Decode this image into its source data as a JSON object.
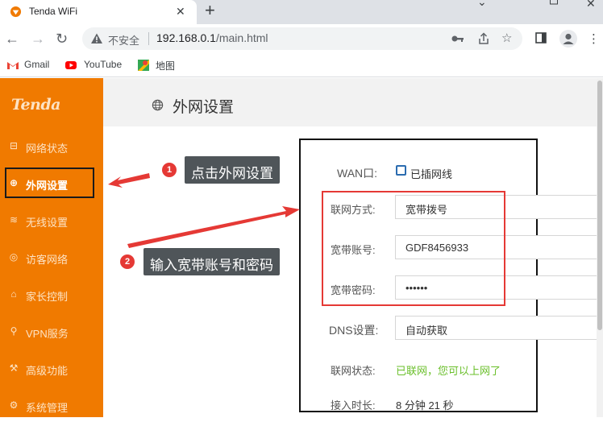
{
  "browser": {
    "tab_title": "Tenda WiFi",
    "tab_close": "✕",
    "new_tab": "+",
    "insecure_label": "不安全",
    "url_host": "192.168.0.1",
    "url_path": "/main.html",
    "bookmarks": [
      {
        "label": "Gmail",
        "icon": "gmail-icon"
      },
      {
        "label": "YouTube",
        "icon": "youtube-icon"
      },
      {
        "label": "地图",
        "icon": "maps-icon"
      }
    ]
  },
  "sidebar": {
    "logo": "Tenda",
    "items": [
      {
        "label": "网络状态",
        "icon": "router-icon"
      },
      {
        "label": "外网设置",
        "icon": "globe-icon",
        "active": true
      },
      {
        "label": "无线设置",
        "icon": "wifi-icon"
      },
      {
        "label": "访客网络",
        "icon": "guest-icon"
      },
      {
        "label": "家长控制",
        "icon": "parental-icon"
      },
      {
        "label": "VPN服务",
        "icon": "vpn-icon"
      },
      {
        "label": "高级功能",
        "icon": "tools-icon"
      },
      {
        "label": "系统管理",
        "icon": "settings-icon"
      }
    ]
  },
  "header": {
    "title": "外网设置"
  },
  "form": {
    "wan_label": "WAN口:",
    "wan_status": "已插网线",
    "conn_type_label": "联网方式:",
    "conn_type_value": "宽带拨号",
    "account_label": "宽带账号:",
    "account_value": "GDF8456933",
    "password_label": "宽带密码:",
    "password_value": "••••••",
    "dns_label": "DNS设置:",
    "dns_value": "自动获取",
    "status_label": "联网状态:",
    "status_value": "已联网，您可以上网了",
    "uptime_label": "接入时长:",
    "uptime_value": "8 分钟 21 秒"
  },
  "annotations": [
    {
      "num": "1",
      "text": "点击外网设置"
    },
    {
      "num": "2",
      "text": "输入宽带账号和密码"
    }
  ],
  "colors": {
    "sidebar": "#f07a00",
    "annotation_red": "#e53935",
    "callout_bg": "#4f5559",
    "status_green": "#6abf2a"
  }
}
